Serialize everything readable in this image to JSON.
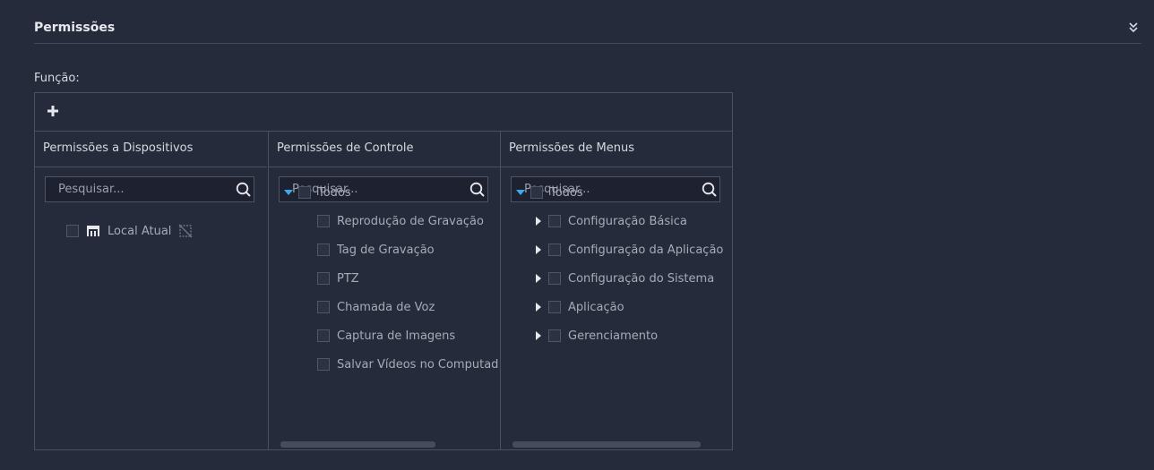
{
  "section": {
    "title": "Permissões",
    "collapse_icon": "double-chevron-down-icon"
  },
  "function_label": "Função:",
  "toolbar": {
    "add_icon": "plus-icon"
  },
  "columns": [
    {
      "title": "Permissões a Dispositivos",
      "search_placeholder": "Pesquisar...",
      "tree": [
        {
          "label": "Local Atual",
          "icon": "device-icon",
          "status_icon": "offline-icon"
        }
      ]
    },
    {
      "title": "Permissões de Controle",
      "search_placeholder": "Pesquisar...",
      "tree": [
        {
          "label": "Todos",
          "expanded": true
        },
        {
          "label": "Reprodução de Gravação"
        },
        {
          "label": "Tag de Gravação"
        },
        {
          "label": "PTZ"
        },
        {
          "label": "Chamada de Voz"
        },
        {
          "label": "Captura de Imagens"
        },
        {
          "label": "Salvar Vídeos no Computad"
        }
      ]
    },
    {
      "title": "Permissões de Menus",
      "search_placeholder": "Pesquisar...",
      "tree": [
        {
          "label": "Todos",
          "expanded": true
        },
        {
          "label": "Configuração Básica",
          "expanded": false
        },
        {
          "label": "Configuração da Aplicação",
          "expanded": false
        },
        {
          "label": "Configuração do Sistema",
          "expanded": false
        },
        {
          "label": "Aplicação",
          "expanded": false
        },
        {
          "label": "Gerenciamento",
          "expanded": false
        }
      ]
    }
  ],
  "colors": {
    "background": "#262b3b",
    "border": "#4a5062",
    "accent": "#3fa9e8",
    "text": "#a6abb6"
  }
}
